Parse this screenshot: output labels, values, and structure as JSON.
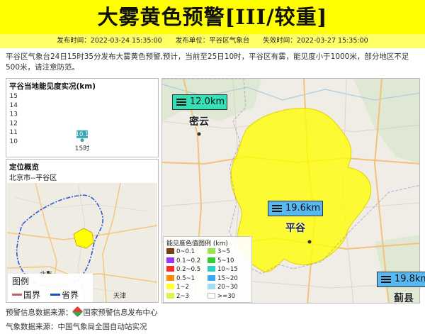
{
  "header": {
    "title": "大雾黄色预警[III/较重]",
    "publish_time": "发布时间：2022-03-24 15:35:00",
    "issuer": "发布单位：平谷区气象台",
    "expire_time": "失效时间：2022-03-27 15:35:00"
  },
  "description": "平谷区气象台24日15时35分发布大雾黄色预警,预计，当前至25日10时，平谷区有雾，能见度小于1000米，部分地区不足500米，请注意防范。",
  "visibility_panel": {
    "title": "平谷当地能见度实况(km)"
  },
  "chart_data": {
    "type": "line",
    "title": "平谷当地能见度实况(km)",
    "categories": [
      "15时"
    ],
    "values": [
      10.1
    ],
    "ylim": [
      10,
      15
    ],
    "yticks": [
      10,
      11,
      12,
      13,
      14,
      15
    ],
    "data_labels": [
      "10.1"
    ],
    "point_color": "#36a6b3"
  },
  "location_panel": {
    "title": "定位概览",
    "subtitle": "北京市--平谷区",
    "labels": {
      "beijing": "北京",
      "tianjin": "天津"
    }
  },
  "map_legend": {
    "title": "图例",
    "items": [
      {
        "label": "国界",
        "color": "#c0636f"
      },
      {
        "label": "省界",
        "color": "#1a4ec7"
      }
    ]
  },
  "visibility_legend": {
    "title": "能见度色值图例 (km)",
    "items": [
      {
        "label": "0~0.1",
        "color": "#7b3f16"
      },
      {
        "label": "3~5",
        "color": "#99e64d"
      },
      {
        "label": "0.1~0.2",
        "color": "#9933ff"
      },
      {
        "label": "5~10",
        "color": "#33cc33"
      },
      {
        "label": "0.2~0.5",
        "color": "#ff2b2b"
      },
      {
        "label": "10~15",
        "color": "#2ecfc6"
      },
      {
        "label": "0.5~1",
        "color": "#ff8c00"
      },
      {
        "label": "15~20",
        "color": "#3ba9f0"
      },
      {
        "label": "1~2",
        "color": "#ffff33"
      },
      {
        "label": "20~30",
        "color": "#a6dbf7"
      },
      {
        "label": "2~3",
        "color": "#e6f04a"
      },
      {
        "label": ">=30",
        "color": "#ffffff"
      }
    ]
  },
  "stations": [
    {
      "name": "密云",
      "value": "12.0km",
      "color": "#35e0b7"
    },
    {
      "name": "平谷",
      "value": "19.6km",
      "color": "#57b8f2"
    },
    {
      "name": "蓟县",
      "value": "19.8km",
      "color": "#57b8f2"
    }
  ],
  "sources": {
    "warning_prefix": "预警信息数据来源：",
    "warning_source": "国家预警信息发布中心",
    "weather_prefix": "气象数据来源：",
    "weather_source": "中国气象局全国自动站实况"
  },
  "colors": {
    "banner": "#ffff00",
    "info_bar": "#ffff66",
    "warning_area": "#ffff00"
  }
}
